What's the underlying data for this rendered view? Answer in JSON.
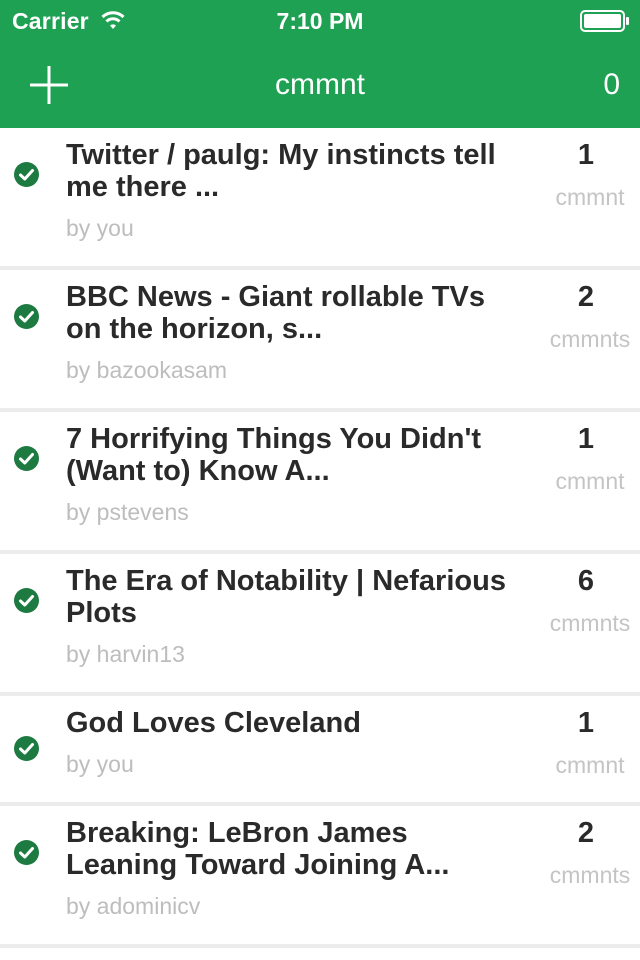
{
  "status_bar": {
    "carrier": "Carrier",
    "time": "7:10 PM"
  },
  "nav": {
    "title": "cmmnt",
    "count": "0"
  },
  "colors": {
    "brand": "#1ea152",
    "check": "#1d7a41"
  },
  "items": [
    {
      "title": "Twitter / paulg: My instincts tell me there ...",
      "author": "by you",
      "count": "1",
      "count_label": "cmmnt"
    },
    {
      "title": "BBC News - Giant rollable TVs on the horizon, s...",
      "author": "by bazookasam",
      "count": "2",
      "count_label": "cmmnts"
    },
    {
      "title": "7 Horrifying Things You Didn't (Want to) Know A...",
      "author": "by pstevens",
      "count": "1",
      "count_label": "cmmnt"
    },
    {
      "title": "The Era of Notability | Nefarious Plots",
      "author": "by harvin13",
      "count": "6",
      "count_label": "cmmnts"
    },
    {
      "title": "God Loves Cleveland",
      "author": "by you",
      "count": "1",
      "count_label": "cmmnt"
    },
    {
      "title": "Breaking: LeBron James Leaning Toward Joining A...",
      "author": "by adominicv",
      "count": "2",
      "count_label": "cmmnts"
    }
  ]
}
